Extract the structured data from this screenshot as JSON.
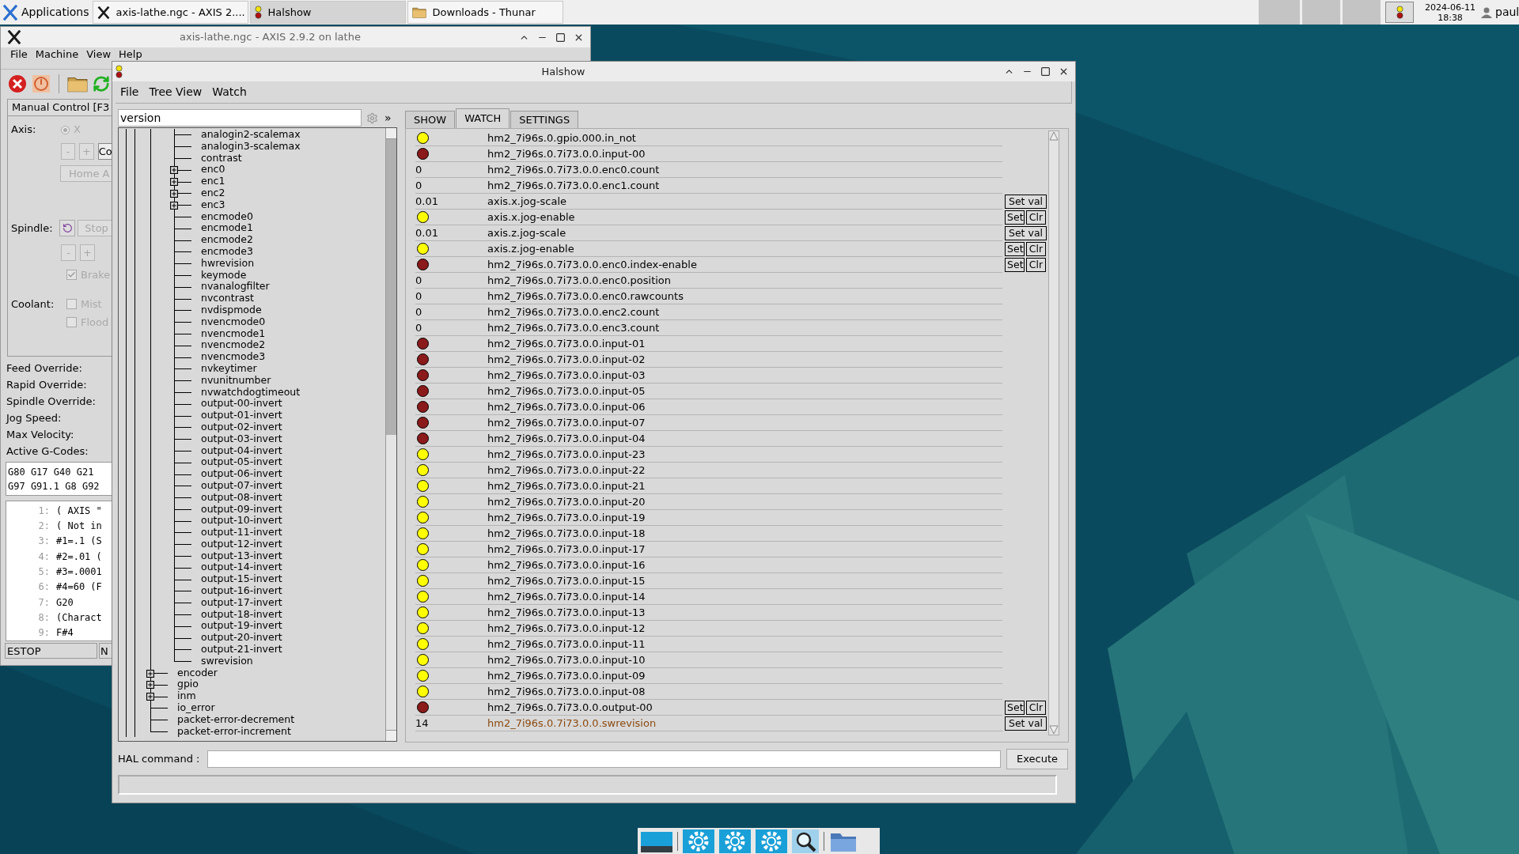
{
  "taskbar": {
    "apps_button": "Applications",
    "tasks": [
      {
        "label": "axis-lathe.ngc - AXIS 2....",
        "kind": "tk",
        "selected": false
      },
      {
        "label": "Halshow",
        "kind": "halshow",
        "selected": true
      },
      {
        "label": "Downloads - Thunar",
        "kind": "folder",
        "selected": false
      }
    ],
    "date": "2024-06-11",
    "time": "18:38",
    "user": "paul"
  },
  "axis": {
    "title": "axis-lathe.ngc - AXIS 2.9.2 on lathe",
    "menu": [
      "File",
      "Machine",
      "View",
      "Help"
    ],
    "tab": "Manual Control [F3",
    "axis_label": "Axis:",
    "axis_option": {
      "label": "X",
      "selected": true
    },
    "jog_buttons": [
      "-",
      "+"
    ],
    "cut_button": "Co",
    "home_button": "Home A",
    "spindle_label": "Spindle:",
    "stop_button": "Stop",
    "spindle_buttons": [
      "-",
      "+"
    ],
    "brake": {
      "label": "Brake",
      "checked": true
    },
    "coolant_label": "Coolant:",
    "coolant": [
      {
        "label": "Mist",
        "checked": false
      },
      {
        "label": "Flood",
        "checked": false
      }
    ],
    "readouts": [
      "Feed Override:",
      "Rapid Override:",
      "Spindle Override:",
      "Jog Speed:",
      "Max Velocity:",
      "Active G-Codes:"
    ],
    "gcodes": [
      "G80 G17 G40 G21",
      "G97 G91.1 G8 G92"
    ],
    "code_lines": [
      {
        "number": "1:",
        "text": "( AXIS \""
      },
      {
        "number": "2:",
        "text": "( Not in"
      },
      {
        "number": "3:",
        "text": "#1=.1 (S"
      },
      {
        "number": "4:",
        "text": "#2=.01 ("
      },
      {
        "number": "5:",
        "text": "#3=.0001"
      },
      {
        "number": "6:",
        "text": "#4=60 (F"
      },
      {
        "number": "7:",
        "text": "G20"
      },
      {
        "number": "8:",
        "text": "(Charact"
      },
      {
        "number": "9:",
        "text": "F#4"
      }
    ],
    "status": [
      "ESTOP",
      "N"
    ]
  },
  "halshow": {
    "title": "Halshow",
    "menu": [
      "File",
      "Tree View",
      "Watch"
    ],
    "search": {
      "value": "version"
    },
    "expand_button": "»",
    "tabs": [
      {
        "label": "SHOW",
        "selected": false
      },
      {
        "label": "WATCH",
        "selected": true
      },
      {
        "label": "SETTINGS",
        "selected": false
      }
    ],
    "tree": [
      {
        "children": [
          {
            "label": "analogin2-scalemax"
          },
          {
            "label": "analogin3-scalemax"
          },
          {
            "label": "contrast"
          },
          {
            "label": "enc0",
            "expanded": false
          },
          {
            "label": "enc1",
            "expanded": false
          },
          {
            "label": "enc2",
            "expanded": false
          },
          {
            "label": "enc3",
            "expanded": false
          },
          {
            "label": "encmode0"
          },
          {
            "label": "encmode1"
          },
          {
            "label": "encmode2"
          },
          {
            "label": "encmode3"
          },
          {
            "label": "hwrevision"
          },
          {
            "label": "keymode"
          },
          {
            "label": "nvanalogfilter"
          },
          {
            "label": "nvcontrast"
          },
          {
            "label": "nvdispmode"
          },
          {
            "label": "nvencmode0"
          },
          {
            "label": "nvencmode1"
          },
          {
            "label": "nvencmode2"
          },
          {
            "label": "nvencmode3"
          },
          {
            "label": "nvkeytimer"
          },
          {
            "label": "nvunitnumber"
          },
          {
            "label": "nvwatchdogtimeout"
          },
          {
            "label": "output-00-invert"
          },
          {
            "label": "output-01-invert"
          },
          {
            "label": "output-02-invert"
          },
          {
            "label": "output-03-invert"
          },
          {
            "label": "output-04-invert"
          },
          {
            "label": "output-05-invert"
          },
          {
            "label": "output-06-invert"
          },
          {
            "label": "output-07-invert"
          },
          {
            "label": "output-08-invert"
          },
          {
            "label": "output-09-invert"
          },
          {
            "label": "output-10-invert"
          },
          {
            "label": "output-11-invert"
          },
          {
            "label": "output-12-invert"
          },
          {
            "label": "output-13-invert"
          },
          {
            "label": "output-14-invert"
          },
          {
            "label": "output-15-invert"
          },
          {
            "label": "output-16-invert"
          },
          {
            "label": "output-17-invert"
          },
          {
            "label": "output-18-invert"
          },
          {
            "label": "output-19-invert"
          },
          {
            "label": "output-20-invert"
          },
          {
            "label": "output-21-invert"
          },
          {
            "label": "swrevision"
          }
        ]
      },
      {
        "label": "encoder",
        "expanded": false
      },
      {
        "label": "gpio",
        "expanded": false
      },
      {
        "label": "inm",
        "expanded": false
      },
      {
        "label": "io_error"
      },
      {
        "label": "packet-error-decrement"
      },
      {
        "label": "packet-error-increment"
      }
    ],
    "watch": [
      {
        "kind": "bit",
        "on": true,
        "name": "hm2_7i96s.0.gpio.000.in_not"
      },
      {
        "kind": "bit",
        "on": false,
        "name": "hm2_7i96s.0.7i73.0.0.input-00"
      },
      {
        "kind": "value",
        "value": "0",
        "name": "hm2_7i96s.0.7i73.0.0.enc0.count"
      },
      {
        "kind": "value",
        "value": "0",
        "name": "hm2_7i96s.0.7i73.0.0.enc1.count"
      },
      {
        "kind": "value",
        "value": "0.01",
        "name": "axis.x.jog-scale",
        "buttons": [
          "Set val"
        ]
      },
      {
        "kind": "bit",
        "on": true,
        "name": "axis.x.jog-enable",
        "buttons": [
          "Set",
          "Clr"
        ]
      },
      {
        "kind": "value",
        "value": "0.01",
        "name": "axis.z.jog-scale",
        "buttons": [
          "Set val"
        ]
      },
      {
        "kind": "bit",
        "on": true,
        "name": "axis.z.jog-enable",
        "buttons": [
          "Set",
          "Clr"
        ]
      },
      {
        "kind": "bit",
        "on": false,
        "name": "hm2_7i96s.0.7i73.0.0.enc0.index-enable",
        "buttons": [
          "Set",
          "Clr"
        ]
      },
      {
        "kind": "value",
        "value": "0",
        "name": "hm2_7i96s.0.7i73.0.0.enc0.position"
      },
      {
        "kind": "value",
        "value": "0",
        "name": "hm2_7i96s.0.7i73.0.0.enc0.rawcounts"
      },
      {
        "kind": "value",
        "value": "0",
        "name": "hm2_7i96s.0.7i73.0.0.enc2.count"
      },
      {
        "kind": "value",
        "value": "0",
        "name": "hm2_7i96s.0.7i73.0.0.enc3.count"
      },
      {
        "kind": "bit",
        "on": false,
        "name": "hm2_7i96s.0.7i73.0.0.input-01"
      },
      {
        "kind": "bit",
        "on": false,
        "name": "hm2_7i96s.0.7i73.0.0.input-02"
      },
      {
        "kind": "bit",
        "on": false,
        "name": "hm2_7i96s.0.7i73.0.0.input-03"
      },
      {
        "kind": "bit",
        "on": false,
        "name": "hm2_7i96s.0.7i73.0.0.input-05"
      },
      {
        "kind": "bit",
        "on": false,
        "name": "hm2_7i96s.0.7i73.0.0.input-06"
      },
      {
        "kind": "bit",
        "on": false,
        "name": "hm2_7i96s.0.7i73.0.0.input-07"
      },
      {
        "kind": "bit",
        "on": false,
        "name": "hm2_7i96s.0.7i73.0.0.input-04"
      },
      {
        "kind": "bit",
        "on": true,
        "name": "hm2_7i96s.0.7i73.0.0.input-23"
      },
      {
        "kind": "bit",
        "on": true,
        "name": "hm2_7i96s.0.7i73.0.0.input-22"
      },
      {
        "kind": "bit",
        "on": true,
        "name": "hm2_7i96s.0.7i73.0.0.input-21"
      },
      {
        "kind": "bit",
        "on": true,
        "name": "hm2_7i96s.0.7i73.0.0.input-20"
      },
      {
        "kind": "bit",
        "on": true,
        "name": "hm2_7i96s.0.7i73.0.0.input-19"
      },
      {
        "kind": "bit",
        "on": true,
        "name": "hm2_7i96s.0.7i73.0.0.input-18"
      },
      {
        "kind": "bit",
        "on": true,
        "name": "hm2_7i96s.0.7i73.0.0.input-17"
      },
      {
        "kind": "bit",
        "on": true,
        "name": "hm2_7i96s.0.7i73.0.0.input-16"
      },
      {
        "kind": "bit",
        "on": true,
        "name": "hm2_7i96s.0.7i73.0.0.input-15"
      },
      {
        "kind": "bit",
        "on": true,
        "name": "hm2_7i96s.0.7i73.0.0.input-14"
      },
      {
        "kind": "bit",
        "on": true,
        "name": "hm2_7i96s.0.7i73.0.0.input-13"
      },
      {
        "kind": "bit",
        "on": true,
        "name": "hm2_7i96s.0.7i73.0.0.input-12"
      },
      {
        "kind": "bit",
        "on": true,
        "name": "hm2_7i96s.0.7i73.0.0.input-11"
      },
      {
        "kind": "bit",
        "on": true,
        "name": "hm2_7i96s.0.7i73.0.0.input-10"
      },
      {
        "kind": "bit",
        "on": true,
        "name": "hm2_7i96s.0.7i73.0.0.input-09"
      },
      {
        "kind": "bit",
        "on": true,
        "name": "hm2_7i96s.0.7i73.0.0.input-08"
      },
      {
        "kind": "bit",
        "on": false,
        "name": "hm2_7i96s.0.7i73.0.0.output-00",
        "buttons": [
          "Set",
          "Clr"
        ]
      },
      {
        "kind": "value",
        "value": "14",
        "name": "hm2_7i96s.0.7i73.0.0.swrevision",
        "param": true,
        "buttons": [
          "Set val"
        ]
      }
    ],
    "hal_command": {
      "label": "HAL command :"
    },
    "execute_button": "Execute"
  }
}
